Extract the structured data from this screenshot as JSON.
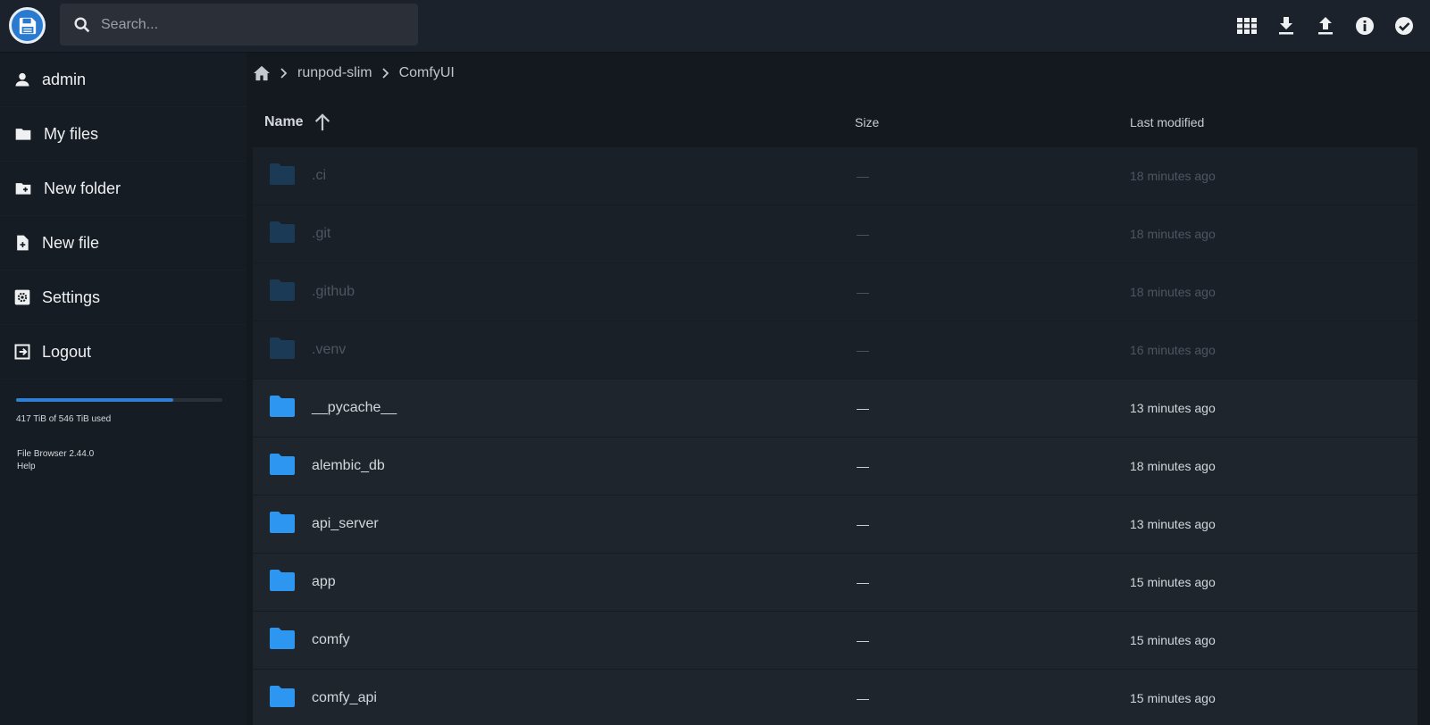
{
  "header": {
    "search_placeholder": "Search...",
    "icons": [
      "grid-view-icon",
      "download-icon",
      "upload-icon",
      "info-icon",
      "select-icon"
    ]
  },
  "sidebar": {
    "items": [
      {
        "label": "admin",
        "icon": "person-icon"
      },
      {
        "label": "My files",
        "icon": "folder-icon"
      },
      {
        "label": "New folder",
        "icon": "new-folder-icon"
      },
      {
        "label": "New file",
        "icon": "new-file-icon"
      },
      {
        "label": "Settings",
        "icon": "settings-icon"
      },
      {
        "label": "Logout",
        "icon": "logout-icon"
      }
    ],
    "usage": {
      "text": "417 TiB of 546 TiB used",
      "fraction": 0.764
    },
    "version": "File Browser 2.44.0",
    "help": "Help"
  },
  "breadcrumb": {
    "items": [
      "runpod-slim",
      "ComfyUI"
    ]
  },
  "table": {
    "headers": {
      "name": "Name",
      "size": "Size",
      "modified": "Last modified"
    },
    "rows": [
      {
        "name": ".ci",
        "size": "—",
        "modified": "18 minutes ago",
        "hidden": true
      },
      {
        "name": ".git",
        "size": "—",
        "modified": "18 minutes ago",
        "hidden": true
      },
      {
        "name": ".github",
        "size": "—",
        "modified": "18 minutes ago",
        "hidden": true
      },
      {
        "name": ".venv",
        "size": "—",
        "modified": "16 minutes ago",
        "hidden": true
      },
      {
        "name": "__pycache__",
        "size": "—",
        "modified": "13 minutes ago",
        "hidden": false
      },
      {
        "name": "alembic_db",
        "size": "—",
        "modified": "18 minutes ago",
        "hidden": false
      },
      {
        "name": "api_server",
        "size": "—",
        "modified": "13 minutes ago",
        "hidden": false
      },
      {
        "name": "app",
        "size": "—",
        "modified": "15 minutes ago",
        "hidden": false
      },
      {
        "name": "comfy",
        "size": "—",
        "modified": "15 minutes ago",
        "hidden": false
      },
      {
        "name": "comfy_api",
        "size": "—",
        "modified": "15 minutes ago",
        "hidden": false
      }
    ]
  },
  "colors": {
    "accent": "#2e7fd6",
    "folder": "#2d96f0",
    "folder_hidden": "#1b3a55"
  }
}
